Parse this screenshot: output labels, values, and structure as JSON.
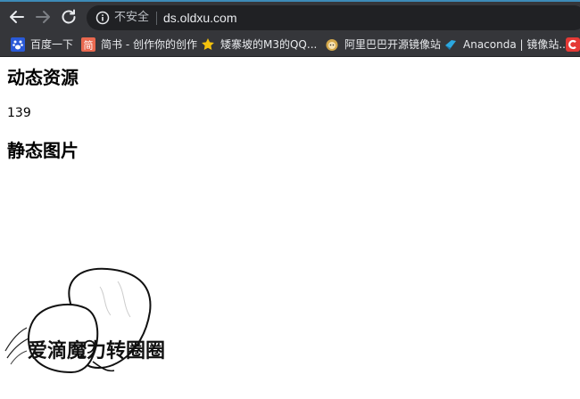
{
  "browser": {
    "security_label": "不安全",
    "url": "ds.oldxu.com",
    "bookmarks": [
      {
        "label": "百度一下",
        "icon": "baidu-paw-icon",
        "color": "#2a5ad8"
      },
      {
        "label": "简书 - 创作你的创作",
        "icon": "jianshu-icon",
        "color": "#e9684f"
      },
      {
        "label": "矮寨坡的M3的QQ...",
        "icon": "star-icon",
        "color": "#f4c20d"
      },
      {
        "label": "阿里巴巴开源镜像站",
        "icon": "alibaba-mirror-icon",
        "color": "#d4a84b"
      },
      {
        "label": "Anaconda | 镜像站...",
        "icon": "anaconda-icon",
        "color": "#2ba8e0"
      }
    ]
  },
  "page": {
    "dynamic_heading": "动态资源",
    "dynamic_value": "139",
    "static_heading": "静态图片",
    "image_caption": "爱滴魔力转圈圈"
  }
}
